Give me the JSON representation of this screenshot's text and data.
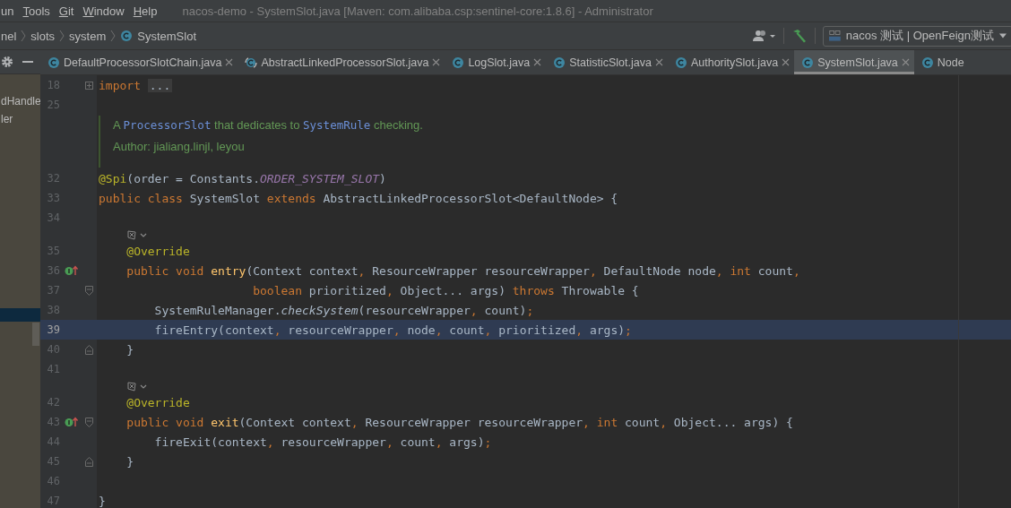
{
  "menu": [
    {
      "label": "un",
      "mnemonic": false
    },
    {
      "label": "Tools",
      "mnemonic": true
    },
    {
      "label": "Git",
      "mnemonic": true
    },
    {
      "label": "Window",
      "mnemonic": true
    },
    {
      "label": "Help",
      "mnemonic": true
    }
  ],
  "window": {
    "title": "nacos-demo - SystemSlot.java [Maven: com.alibaba.csp:sentinel-core:1.8.6] - Administrator"
  },
  "breadcrumbs": [
    {
      "label": "nel",
      "kind": "folder"
    },
    {
      "label": "slots",
      "kind": "folder"
    },
    {
      "label": "system",
      "kind": "folder"
    },
    {
      "label": "SystemSlot",
      "kind": "class"
    }
  ],
  "run_config": {
    "label": "nacos 测试 | OpenFeign测试"
  },
  "project_panel": {
    "items": [
      {
        "label": "dHandle",
        "selected": false
      },
      {
        "label": "ler",
        "selected": false
      }
    ]
  },
  "tabs": [
    {
      "label": "DefaultProcessorSlotChain.java",
      "kind": "class",
      "selected": false,
      "closable": true
    },
    {
      "label": "AbstractLinkedProcessorSlot.java",
      "kind": "abstract",
      "selected": false,
      "closable": true
    },
    {
      "label": "LogSlot.java",
      "kind": "class",
      "selected": false,
      "closable": true
    },
    {
      "label": "StatisticSlot.java",
      "kind": "class",
      "selected": false,
      "closable": true
    },
    {
      "label": "AuthoritySlot.java",
      "kind": "class",
      "selected": false,
      "closable": true
    },
    {
      "label": "SystemSlot.java",
      "kind": "class",
      "selected": true,
      "closable": true
    },
    {
      "label": "Node",
      "kind": "class",
      "selected": false,
      "closable": false
    }
  ],
  "lines": [
    {
      "kind": "code",
      "number": "18",
      "folded": true,
      "tokens": [
        {
          "t": "import ",
          "kind": "keyword"
        },
        {
          "t": "...",
          "kind": "placeholder"
        }
      ]
    },
    {
      "kind": "code",
      "number": "25"
    },
    {
      "kind": "doc",
      "paragraphs": [
        [
          {
            "t": "A "
          },
          {
            "t": "ProcessorSlot",
            "kind": "code"
          },
          {
            "t": " that dedicates to "
          },
          {
            "t": "SystemRule",
            "kind": "code"
          },
          {
            "t": " checking."
          }
        ],
        [
          {
            "t": "Author: jialiang.linjl, leyou"
          }
        ]
      ]
    },
    {
      "kind": "code",
      "number": "32",
      "tokens": [
        {
          "t": "@Spi",
          "kind": "annotation"
        },
        {
          "t": "(order = Constants."
        },
        {
          "t": "ORDER_SYSTEM_SLOT",
          "kind": "constant"
        },
        {
          "t": ")"
        }
      ]
    },
    {
      "kind": "code",
      "number": "33",
      "tokens": [
        {
          "t": "public class ",
          "kind": "keyword"
        },
        {
          "t": "SystemSlot "
        },
        {
          "t": "extends ",
          "kind": "keyword"
        },
        {
          "t": "AbstractLinkedProcessorSlot<DefaultNode> {"
        }
      ]
    },
    {
      "kind": "code",
      "number": "34"
    },
    {
      "kind": "hint"
    },
    {
      "kind": "code",
      "number": "35",
      "tokens": [
        {
          "t": "    @Override",
          "kind": "annotation"
        }
      ]
    },
    {
      "kind": "code",
      "number": "36",
      "overrides": true,
      "tokens": [
        {
          "t": "    public void ",
          "kind": "keyword"
        },
        {
          "t": "entry",
          "kind": "method"
        },
        {
          "t": "(Context context"
        },
        {
          "t": ", ",
          "kind": "keyword"
        },
        {
          "t": "ResourceWrapper resourceWrapper"
        },
        {
          "t": ", ",
          "kind": "keyword"
        },
        {
          "t": "DefaultNode node"
        },
        {
          "t": ", ",
          "kind": "keyword"
        },
        {
          "t": "int ",
          "kind": "keyword"
        },
        {
          "t": "count"
        },
        {
          "t": ",",
          "kind": "keyword"
        }
      ]
    },
    {
      "kind": "code",
      "number": "37",
      "fold_start": true,
      "tokens": [
        {
          "t": "                      boolean ",
          "kind": "keyword"
        },
        {
          "t": "prioritized"
        },
        {
          "t": ", ",
          "kind": "keyword"
        },
        {
          "t": "Object... args) "
        },
        {
          "t": "throws ",
          "kind": "keyword"
        },
        {
          "t": "Throwable {"
        }
      ]
    },
    {
      "kind": "code",
      "number": "38",
      "tokens": [
        {
          "t": "        SystemRuleManager."
        },
        {
          "t": "checkSystem",
          "kind": "static_call"
        },
        {
          "t": "(resourceWrapper"
        },
        {
          "t": ", ",
          "kind": "keyword"
        },
        {
          "t": "count)"
        },
        {
          "t": ";",
          "kind": "keyword"
        }
      ]
    },
    {
      "kind": "code",
      "number": "39",
      "current": true,
      "tokens": [
        {
          "t": "        fireEntry(context"
        },
        {
          "t": ", ",
          "kind": "keyword"
        },
        {
          "t": "resourceWrapper"
        },
        {
          "t": ", ",
          "kind": "keyword"
        },
        {
          "t": "node"
        },
        {
          "t": ", ",
          "kind": "keyword"
        },
        {
          "t": "count"
        },
        {
          "t": ", ",
          "kind": "keyword"
        },
        {
          "t": "prioritized"
        },
        {
          "t": ", ",
          "kind": "keyword"
        },
        {
          "t": "args)"
        },
        {
          "t": ";",
          "kind": "keyword"
        }
      ]
    },
    {
      "kind": "code",
      "number": "40",
      "fold_end": true,
      "tokens": [
        {
          "t": "    }"
        }
      ]
    },
    {
      "kind": "code",
      "number": "41"
    },
    {
      "kind": "hint"
    },
    {
      "kind": "code",
      "number": "42",
      "tokens": [
        {
          "t": "    @Override",
          "kind": "annotation"
        }
      ]
    },
    {
      "kind": "code",
      "number": "43",
      "overrides": true,
      "fold_start": true,
      "tokens": [
        {
          "t": "    public void ",
          "kind": "keyword"
        },
        {
          "t": "exit",
          "kind": "method"
        },
        {
          "t": "(Context context"
        },
        {
          "t": ", ",
          "kind": "keyword"
        },
        {
          "t": "ResourceWrapper resourceWrapper"
        },
        {
          "t": ", ",
          "kind": "keyword"
        },
        {
          "t": "int ",
          "kind": "keyword"
        },
        {
          "t": "count"
        },
        {
          "t": ", ",
          "kind": "keyword"
        },
        {
          "t": "Object... args) {"
        }
      ]
    },
    {
      "kind": "code",
      "number": "44",
      "tokens": [
        {
          "t": "        fireExit(context"
        },
        {
          "t": ", ",
          "kind": "keyword"
        },
        {
          "t": "resourceWrapper"
        },
        {
          "t": ", ",
          "kind": "keyword"
        },
        {
          "t": "count"
        },
        {
          "t": ", ",
          "kind": "keyword"
        },
        {
          "t": "args)"
        },
        {
          "t": ";",
          "kind": "keyword"
        }
      ]
    },
    {
      "kind": "code",
      "number": "45",
      "fold_end": true,
      "tokens": [
        {
          "t": "    }"
        }
      ]
    },
    {
      "kind": "code",
      "number": "46"
    },
    {
      "kind": "code",
      "number": "47",
      "tokens": [
        {
          "t": "}"
        }
      ]
    }
  ]
}
